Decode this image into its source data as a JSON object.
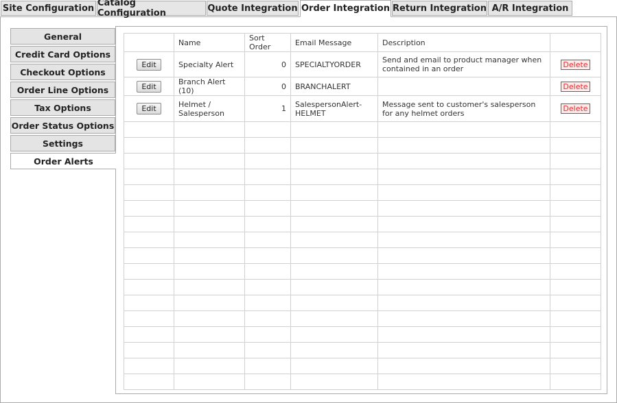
{
  "top_tabs": [
    {
      "label": "Site Configuration",
      "active": false
    },
    {
      "label": "Catalog Configuration",
      "active": false
    },
    {
      "label": "Quote Integration",
      "active": false
    },
    {
      "label": "Order Integration",
      "active": true
    },
    {
      "label": "Return Integration",
      "active": false
    },
    {
      "label": "A/R Integration",
      "active": false
    }
  ],
  "side_menu": [
    {
      "label": "General",
      "active": false
    },
    {
      "label": "Credit Card Options",
      "active": false
    },
    {
      "label": "Checkout Options",
      "active": false
    },
    {
      "label": "Order Line Options",
      "active": false
    },
    {
      "label": "Tax Options",
      "active": false
    },
    {
      "label": "Order Status Options",
      "active": false
    },
    {
      "label": "Settings",
      "active": false
    },
    {
      "label": "Order Alerts",
      "active": true
    }
  ],
  "table": {
    "columns": [
      "",
      "Name",
      "Sort Order",
      "Email Message",
      "Description",
      ""
    ],
    "edit_label": "Edit",
    "delete_label": "Delete",
    "rows": [
      {
        "name": "Specialty Alert",
        "sort_order": "0",
        "email_message": "SPECIALTYORDER",
        "description": "Send and email to product manager when contained in an order"
      },
      {
        "name": "Branch Alert (10)",
        "sort_order": "0",
        "email_message": "BRANCHALERT",
        "description": ""
      },
      {
        "name": "Helmet / Salesperson",
        "sort_order": "1",
        "email_message": "SalespersonAlert-HELMET",
        "description": "Message sent to customer's salesperson for any helmet orders"
      }
    ],
    "empty_rows": 17
  },
  "colors": {
    "border": "#a9a9a9",
    "tab_bg": "#e6e6e6",
    "delete": "#e52b2b"
  }
}
